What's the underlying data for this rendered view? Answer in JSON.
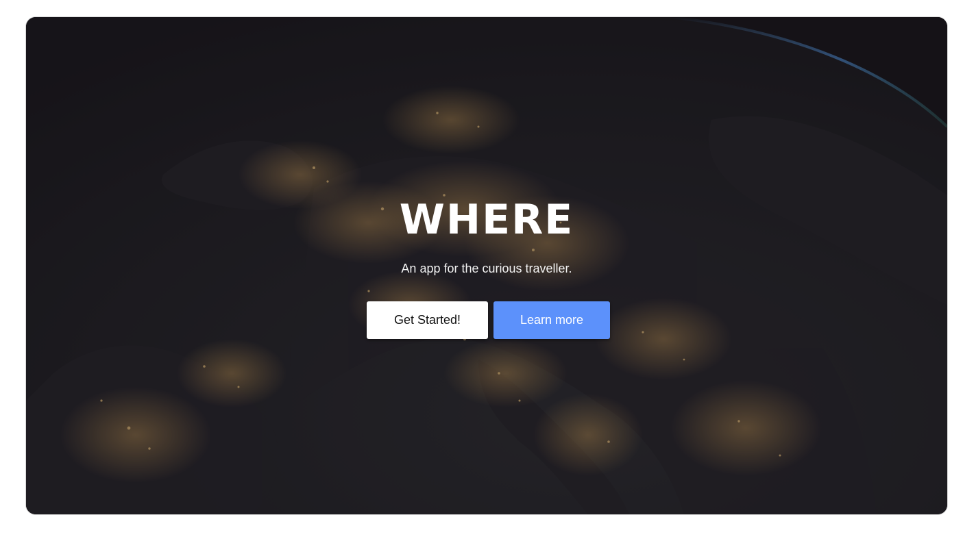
{
  "hero": {
    "title": "WHERE",
    "subtitle": "An app for the curious traveller.",
    "primary_button_label": "Get Started!",
    "secondary_button_label": "Learn more",
    "background_image": "night-earth-europe-city-lights"
  },
  "colors": {
    "overlay": "#17151a",
    "city_lights": "#e0b060",
    "atmosphere": "#3a78c8",
    "primary_button_bg": "#ffffff",
    "secondary_button_bg": "#5c91fb",
    "title_text": "#ffffff"
  }
}
